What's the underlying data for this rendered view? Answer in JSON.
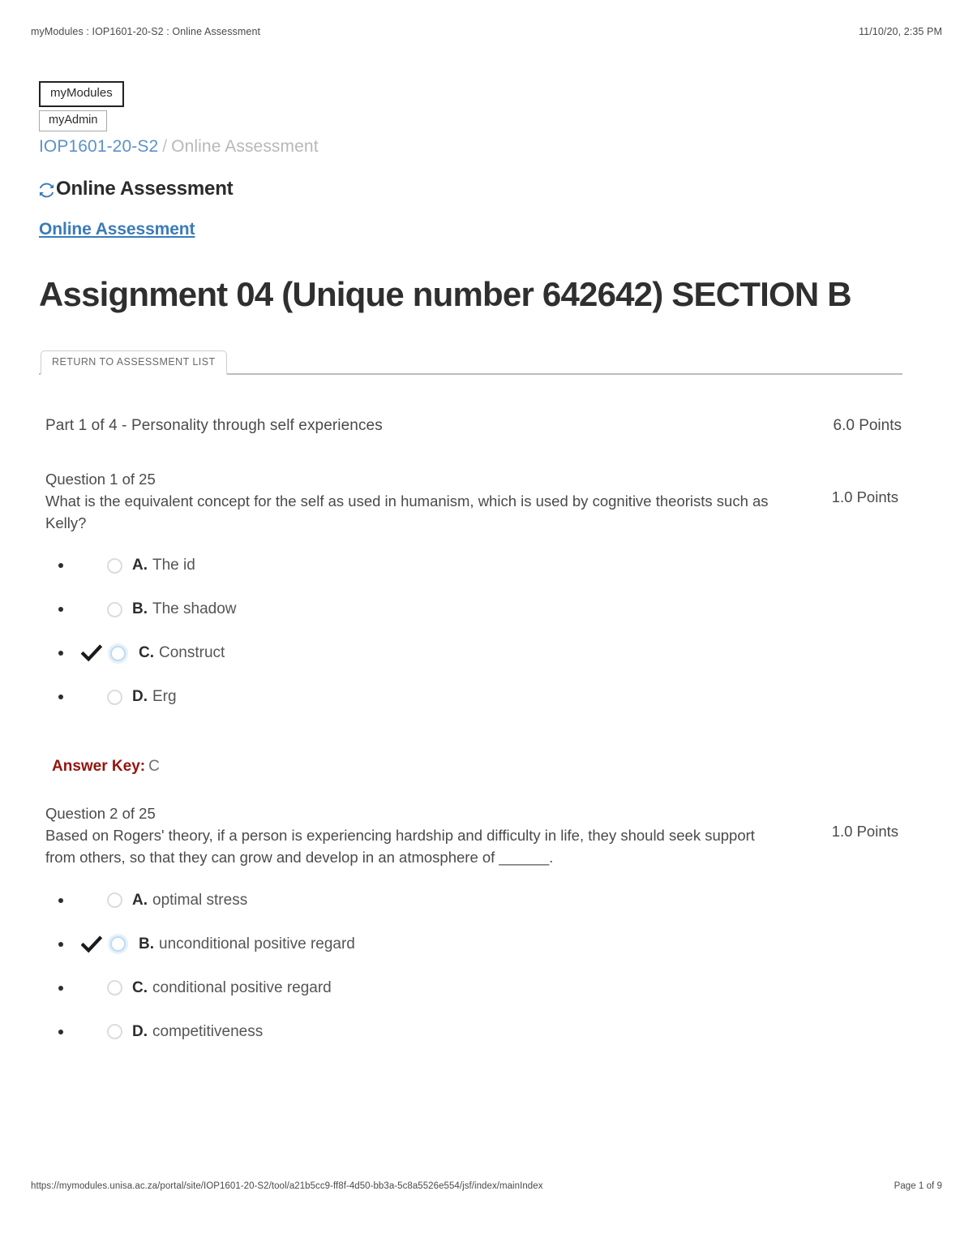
{
  "print": {
    "header_title": "myModules : IOP1601-20-S2 : Online Assessment",
    "header_timestamp": "11/10/20, 2:35 PM",
    "footer_url": "https://mymodules.unisa.ac.za/portal/site/IOP1601-20-S2/tool/a21b5cc9-ff8f-4d50-bb3a-5c8a5526e554/jsf/index/mainIndex",
    "footer_page": "Page 1 of 9"
  },
  "nav": {
    "my_modules": "myModules",
    "my_admin": "myAdmin"
  },
  "breadcrumb": {
    "site": "IOP1601-20-S2",
    "separator": "/",
    "current": "Online Assessment"
  },
  "tool": {
    "heading": "Online Assessment",
    "refresh_icon": "refresh-icon",
    "link": "Online Assessment"
  },
  "assessment": {
    "title": "Assignment 04 (Unique number 642642) SECTION B",
    "return_button": "RETURN TO ASSESSMENT LIST"
  },
  "part": {
    "title": "Part 1 of 4 - Personality through self experiences",
    "points": "6.0 Points"
  },
  "questions": [
    {
      "number": "Question 1 of 25",
      "text": "What is the equivalent concept for the self as used in humanism, which is used by cognitive theorists such as Kelly?",
      "points": "1.0 Points",
      "options": [
        {
          "letter": "A.",
          "text": "The id",
          "selected": false
        },
        {
          "letter": "B.",
          "text": "The shadow",
          "selected": false
        },
        {
          "letter": "C.",
          "text": "Construct",
          "selected": true
        },
        {
          "letter": "D.",
          "text": "Erg",
          "selected": false
        }
      ],
      "answer_key_label": "Answer Key:",
      "answer_key_value": "C"
    },
    {
      "number": "Question 2 of 25",
      "text": "Based on Rogers' theory, if a person is experiencing hardship and difficulty in life, they should seek support from others, so that they can grow and develop in an atmosphere of ______.",
      "points": "1.0 Points",
      "options": [
        {
          "letter": "A.",
          "text": "optimal stress",
          "selected": false
        },
        {
          "letter": "B.",
          "text": "unconditional positive regard",
          "selected": true
        },
        {
          "letter": "C.",
          "text": "conditional positive regard",
          "selected": false
        },
        {
          "letter": "D.",
          "text": "competitiveness",
          "selected": false
        }
      ]
    }
  ],
  "colors": {
    "link_blue": "#3a7bb8",
    "breadcrumb_blue": "#5b93c9",
    "answer_key_red": "#96130f",
    "radio_selected_blue": "#bddcf3"
  }
}
